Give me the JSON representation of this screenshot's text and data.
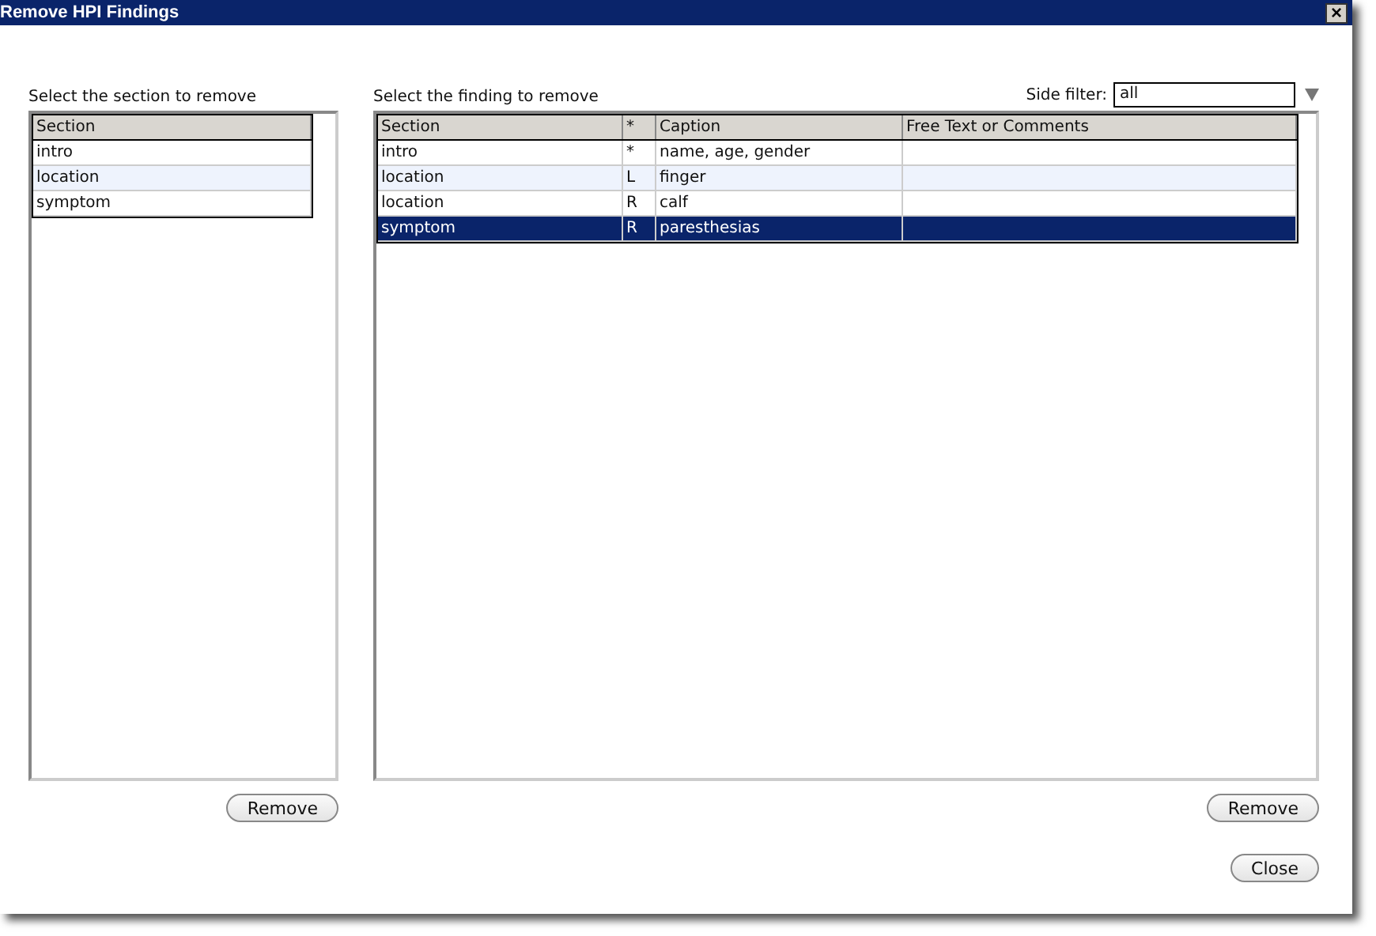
{
  "window": {
    "title": "Remove HPI Findings",
    "close": "×"
  },
  "sections_panel": {
    "label": "Select the section to remove",
    "columns": [
      "Section"
    ],
    "rows": [
      {
        "cells": [
          "intro"
        ]
      },
      {
        "cells": [
          "location"
        ]
      },
      {
        "cells": [
          "symptom"
        ]
      }
    ],
    "button": "Remove"
  },
  "findings_panel": {
    "label": "Select the finding to remove",
    "side_filter": {
      "label": "Side filter:",
      "value": "all"
    },
    "columns": [
      "Section",
      "*",
      "Caption",
      "Free Text or Comments"
    ],
    "rows": [
      {
        "cells": [
          "intro",
          "*",
          "name, age, gender",
          ""
        ],
        "selected": false
      },
      {
        "cells": [
          "location",
          "L",
          "finger",
          ""
        ],
        "selected": false
      },
      {
        "cells": [
          "location",
          "R",
          "calf",
          ""
        ],
        "selected": false
      },
      {
        "cells": [
          "symptom",
          "R",
          "paresthesias",
          ""
        ],
        "selected": true
      }
    ],
    "button": "Remove"
  },
  "close_button": "Close"
}
